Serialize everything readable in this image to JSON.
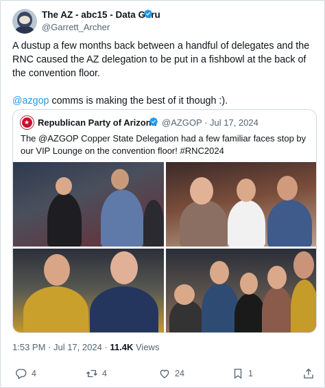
{
  "tweet": {
    "author_name": "The AZ - abc15 - Data Guru",
    "author_handle": "@Garrett_Archer",
    "text_line1": "A dustup a few months back between a handful of delegates and the RNC caused the AZ delegation to be put in a fishbowl at the back of the convention floor.",
    "text_mention": "@azgop",
    "text_line2_rest": " comms is making the best of it though :).",
    "timestamp": "1:53 PM · Jul 17, 2024",
    "views_count": "11.4K",
    "views_label": "Views"
  },
  "quoted": {
    "author_name": "Republican Party of Arizona",
    "author_handle": "@AZGOP · Jul 17, 2024",
    "text": "The @AZGOP Copper State Delegation had a few familiar faces stop by our VIP Lounge on the convention floor! #RNC2024"
  },
  "actions": {
    "reply_count": "4",
    "retweet_count": "4",
    "like_count": "24",
    "bookmark_count": "1"
  },
  "icons": {
    "verified": "verified-badge-icon",
    "reply": "reply-icon",
    "retweet": "retweet-icon",
    "like": "heart-icon",
    "bookmark": "bookmark-icon",
    "share": "share-icon"
  },
  "colors": {
    "accent": "#1d9bf0",
    "text": "#0f1419",
    "muted": "#536471",
    "border": "#cfd9de"
  }
}
